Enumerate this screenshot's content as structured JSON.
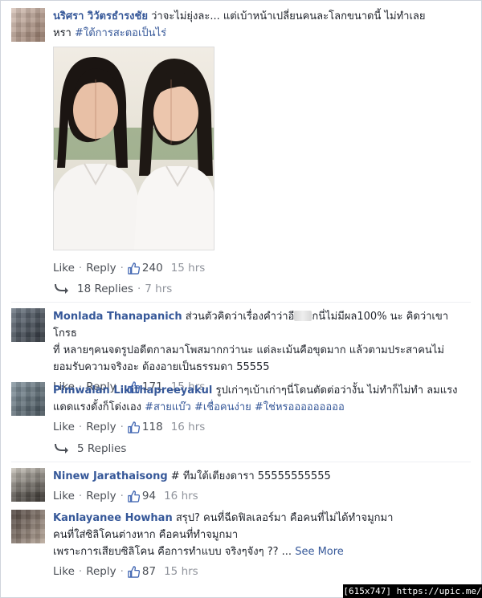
{
  "comments": [
    {
      "author": "นริศรา วิวัตรธำรงชัย",
      "text_line1": " ว่าจะไม่ยุ่งละ... แต่เบ้าหน้าเปลี่ยนคนละโลกขนาดนี้ ไม่ทำเลย",
      "text_line2": "หรา ",
      "hashtag": "#ใต้การสะตอเป็นไร่",
      "like_label": "Like",
      "reply_label": "Reply",
      "likes": "240",
      "time": "15 hrs",
      "replies_label": "18 Replies",
      "replies_time": "7 hrs"
    },
    {
      "author": "Monlada Thanapanich",
      "text_a": " ส่วนตัวคิดว่าเรื่องคำว่าอี",
      "text_b": "กนี่ไม่มีผล100% นะ คิดว่าเขาโกรธ",
      "text_line2": "ที่ หลายๆคนจดรูปอดีตกาลมาโพสมากกว่านะ แต่ละเม้นคือขุดมาก แล้วตามประสาคนไม่",
      "text_line3": "ยอมรับความจริงอะ ต้องอายเป็นธรรมดา 55555",
      "like_label": "Like",
      "reply_label": "Reply",
      "likes": "171",
      "time": "15 hrs"
    },
    {
      "author": "Pimwalan Likithapreeyakul",
      "text_line1": " รูปเก่าๆเบ้าเก่าๆนี่โดนตัดต่อว่างั้น ไม่ทำก็ไม่ทำ ลมแรง",
      "text_line2": "แดดแรงดั้งก็โด่งเอง ",
      "hashtags": "#สายแบ๊ว #เชื่อคนง่าย #ใช่หรอออออออออ",
      "like_label": "Like",
      "reply_label": "Reply",
      "likes": "118",
      "time": "16 hrs",
      "replies_label": "5 Replies"
    },
    {
      "author": "Ninew Jarathaisong",
      "text_line1": " # ทีมใต้เตียงดารา 55555555555",
      "like_label": "Like",
      "reply_label": "Reply",
      "likes": "94",
      "time": "16 hrs"
    },
    {
      "author": "Kanlayanee Howhan",
      "text_line1": " สรุป? คนที่ฉีดฟิลเลอร์มา คือคนที่ไม่ได้ทำจมูกมา",
      "text_line2": "คนที่ใส่ซิลิโคนต่างหาก คือคนที่ทำจมูกมา",
      "text_line3": "เพราะการเสียบซิลิโคน คือการทำแบบ จริงๆจังๆ ?? ... ",
      "see_more": "See More",
      "like_label": "Like",
      "reply_label": "Reply",
      "likes": "87",
      "time": "15 hrs"
    }
  ],
  "watermark": "[615x747] https://upic.me/",
  "colors": {
    "link": "#365899",
    "meta": "#90949c",
    "action": "#4b4f56"
  },
  "icons": [
    "like-thumb-icon",
    "reply-arrow-icon"
  ]
}
